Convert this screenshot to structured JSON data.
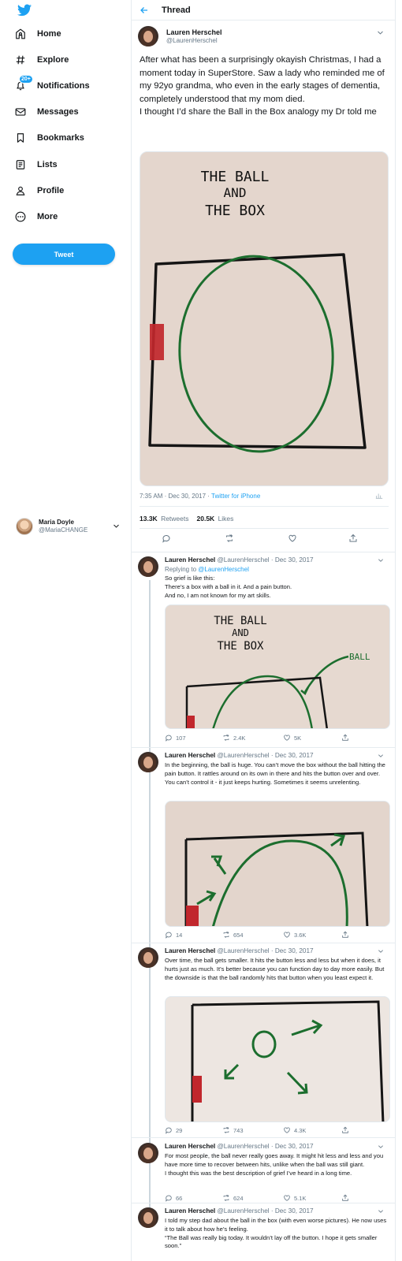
{
  "brand": {
    "accent": "#1da1f2",
    "logo_icon": "twitter-bird-icon"
  },
  "nav": {
    "items": [
      {
        "label": "Home",
        "icon": "home-icon"
      },
      {
        "label": "Explore",
        "icon": "hashtag-icon"
      },
      {
        "label": "Notifications",
        "icon": "bell-icon",
        "badge": "20+"
      },
      {
        "label": "Messages",
        "icon": "envelope-icon"
      },
      {
        "label": "Bookmarks",
        "icon": "bookmark-icon"
      },
      {
        "label": "Lists",
        "icon": "list-icon"
      },
      {
        "label": "Profile",
        "icon": "person-icon"
      },
      {
        "label": "More",
        "icon": "more-circle-icon"
      }
    ],
    "tweet_button": "Tweet"
  },
  "account": {
    "name": "Maria Doyle",
    "handle": "@MariaCHANGE"
  },
  "header": {
    "title": "Thread"
  },
  "main_tweet": {
    "name": "Lauren Herschel",
    "handle": "@LaurenHerschel",
    "text": "After what has been a surprisingly okayish Christmas, I had a moment today in SuperStore. Saw a lady who reminded me of my 92yo grandma, who even in the early stages of dementia, completely understood that my mom died.\nI thought I’d share the Ball in the Box analogy my Dr told me",
    "image_caption": {
      "line1": "THE BALL",
      "line2": "AND",
      "line3": "THE BOX"
    },
    "time": "7:35 AM · Dec 30, 2017 · ",
    "source": "Twitter for iPhone",
    "retweets": "13.3K",
    "retweets_label": "Retweets",
    "likes": "20.5K",
    "likes_label": "Likes"
  },
  "replies": [
    {
      "name": "Lauren Herschel",
      "handle": "@LaurenHerschel · Dec 30, 2017",
      "replying_prefix": "Replying to ",
      "replying_to": "@LaurenHerschel",
      "text": "So grief is like this:\nThere’s a box with a ball in it. And a pain button.\nAnd no, I am not known for my art skills.",
      "image_caption": {
        "line1": "THE BALL",
        "line2": "AND",
        "line3": "THE BOX",
        "label": "BALL"
      },
      "replies": "107",
      "retweets": "2.4K",
      "likes": "5K"
    },
    {
      "name": "Lauren Herschel",
      "handle": "@LaurenHerschel · Dec 30, 2017",
      "text": "In the beginning, the ball is huge. You can’t move the box without the ball hitting the pain button. It rattles around on its own in there and hits the button over and over. You can’t control it - it just keeps hurting. Sometimes it seems unrelenting.",
      "replies": "14",
      "retweets": "654",
      "likes": "3.6K"
    },
    {
      "name": "Lauren Herschel",
      "handle": "@LaurenHerschel · Dec 30, 2017",
      "text": "Over time, the ball gets smaller. It hits the button less and less but when it does, it hurts just as much. It’s better because you can function day to day more easily. But the downside is that the ball randomly hits that button when you least expect it.",
      "replies": "29",
      "retweets": "743",
      "likes": "4.3K"
    },
    {
      "name": "Lauren Herschel",
      "handle": "@LaurenHerschel · Dec 30, 2017",
      "text": "For most people, the ball never really goes away. It might hit less and less and you have more time to recover between hits, unlike when the ball was still giant.\nI thought this was the best description of grief I’ve heard in a long time.",
      "replies": "66",
      "retweets": "624",
      "likes": "5.1K"
    },
    {
      "name": "Lauren Herschel",
      "handle": "@LaurenHerschel · Dec 30, 2017",
      "text": "I told my step dad about the ball in the box (with even worse pictures). He now uses it to talk about how he’s feeling.\n“The Ball was really big today. It wouldn’t lay off the button. I hope it gets smaller soon.”"
    }
  ]
}
